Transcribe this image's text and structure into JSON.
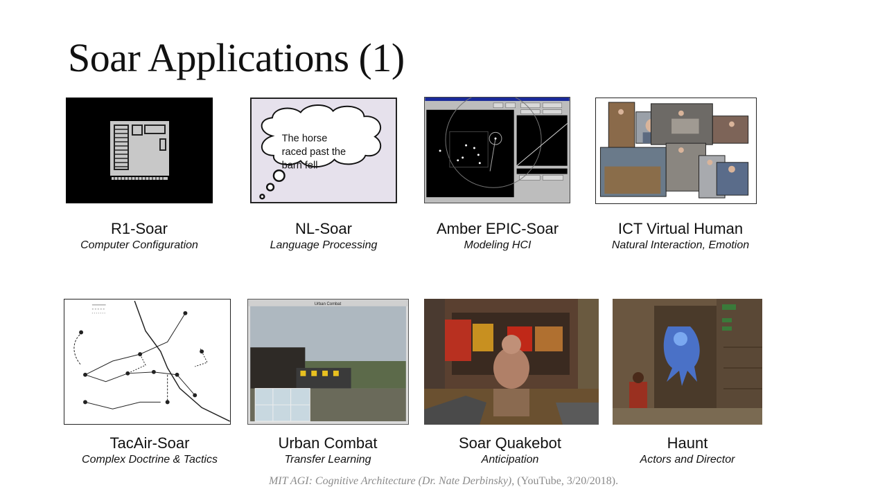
{
  "slide": {
    "title": "Soar Applications (1)"
  },
  "thumbnails": {
    "nl_soar_bubble": [
      "The horse",
      "raced past the",
      "barn fell"
    ],
    "urban_combat_window_title": "Urban Combat"
  },
  "applications": [
    {
      "name": "R1-Soar",
      "subtitle": "Computer Configuration"
    },
    {
      "name": "NL-Soar",
      "subtitle": "Language Processing"
    },
    {
      "name": "Amber EPIC-Soar",
      "subtitle": "Modeling HCI"
    },
    {
      "name": "ICT Virtual Human",
      "subtitle": "Natural Interaction, Emotion"
    },
    {
      "name": "TacAir-Soar",
      "subtitle": "Complex Doctrine & Tactics"
    },
    {
      "name": "Urban Combat",
      "subtitle": "Transfer Learning"
    },
    {
      "name": "Soar Quakebot",
      "subtitle": "Anticipation"
    },
    {
      "name": "Haunt",
      "subtitle": "Actors and Director"
    }
  ],
  "footer": {
    "source_italic": "MIT AGI: Cognitive Architecture (Dr. Nate Derbinsky)",
    "source_rest": ", (YouTube, 3/20/2018)."
  }
}
